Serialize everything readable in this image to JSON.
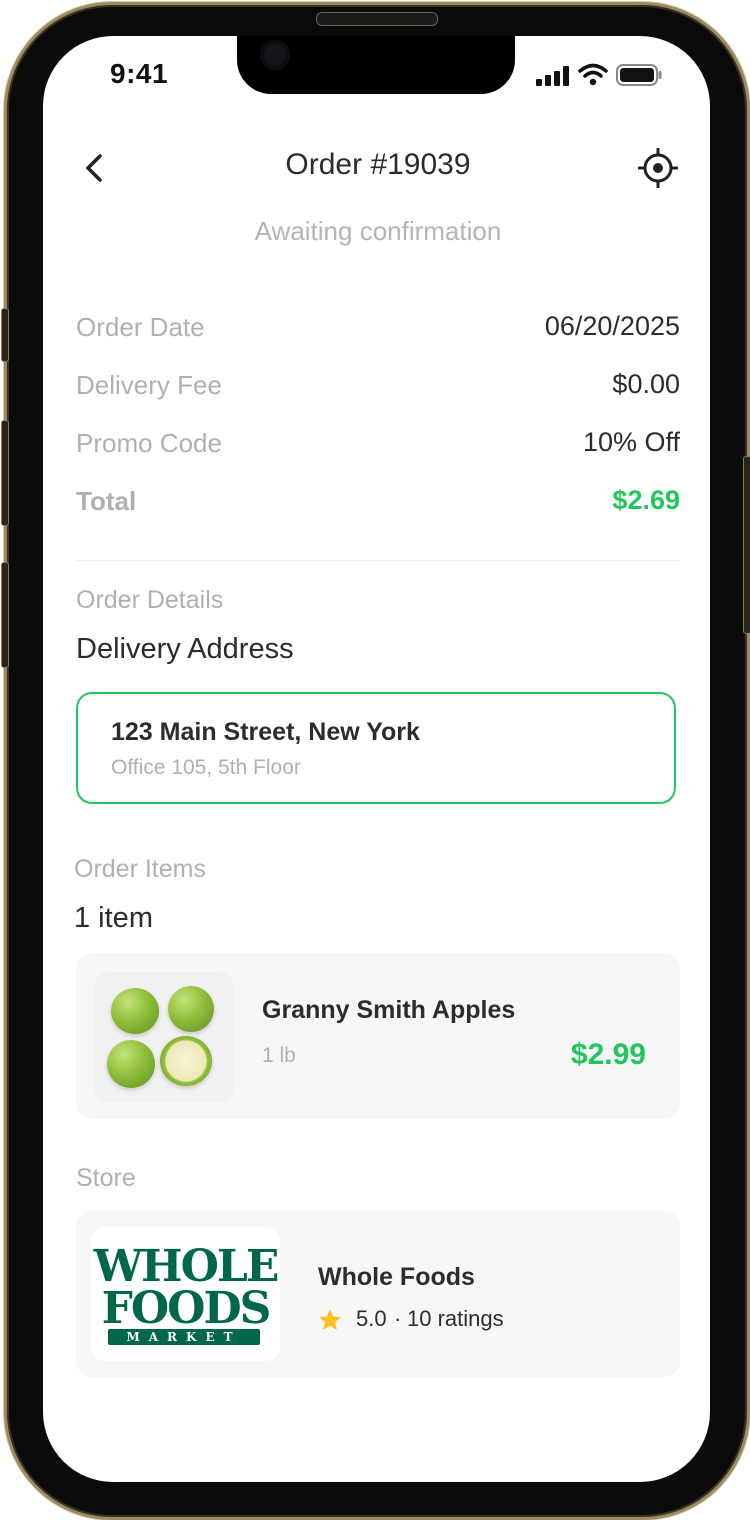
{
  "status_bar": {
    "time": "9:41"
  },
  "header": {
    "title": "Order #19039",
    "status": "Awaiting confirmation"
  },
  "summary": [
    {
      "label": "Order Date",
      "value": "06/20/2025"
    },
    {
      "label": "Delivery Fee",
      "value": "$0.00"
    },
    {
      "label": "Promo Code",
      "value": "10% Off"
    },
    {
      "label": "Total",
      "value": "$2.69"
    }
  ],
  "order_details": {
    "section_label": "Order Details",
    "heading": "Delivery Address",
    "address_line1": "123 Main Street, New York",
    "address_line2": "Office 105, 5th Floor"
  },
  "order_items": {
    "section_label": "Order Items",
    "count_label": "1 item",
    "items": [
      {
        "name": "Granny Smith Apples",
        "quantity": "1 lb",
        "price": "$2.99"
      }
    ]
  },
  "store": {
    "section_label": "Store",
    "logo_text": [
      "WHOLE",
      "FOODS",
      "MARKET"
    ],
    "name": "Whole Foods",
    "rating": "5.0",
    "ratings_count": "10 ratings"
  },
  "colors": {
    "accent": "#22c55e",
    "brand_green": "#00674b",
    "star": "#fbbf24"
  },
  "icons": {
    "back": "chevron-left-icon",
    "locate": "crosshair-icon",
    "star": "star-icon"
  }
}
